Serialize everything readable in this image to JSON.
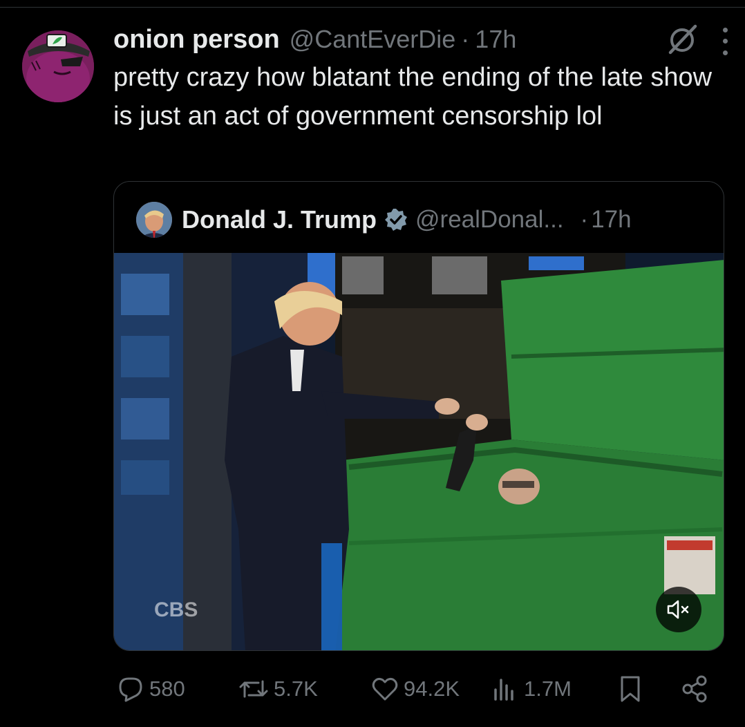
{
  "tweet": {
    "author_name": "onion person",
    "handle": "@CantEverDie",
    "separator": "·",
    "time": "17h",
    "text": "pretty crazy how blatant the ending of the late show is just an act of government censorship lol"
  },
  "quote": {
    "author_name": "Donald J. Trump",
    "handle": "@realDonal...",
    "separator": "·",
    "time": "17h",
    "media_watermark": "CBS"
  },
  "actions": {
    "replies": "580",
    "reposts": "5.7K",
    "likes": "94.2K",
    "views": "1.7M"
  },
  "colors": {
    "background": "#000000",
    "text_primary": "#e7e9ea",
    "text_secondary": "#71767b",
    "border": "#2f3336",
    "verified": "#829aab"
  },
  "icons": {
    "header": [
      "grok-icon",
      "more-icon"
    ],
    "actions": [
      "reply-icon",
      "repost-icon",
      "like-icon",
      "views-icon",
      "bookmark-icon",
      "share-icon"
    ],
    "media": [
      "mute-icon"
    ]
  }
}
